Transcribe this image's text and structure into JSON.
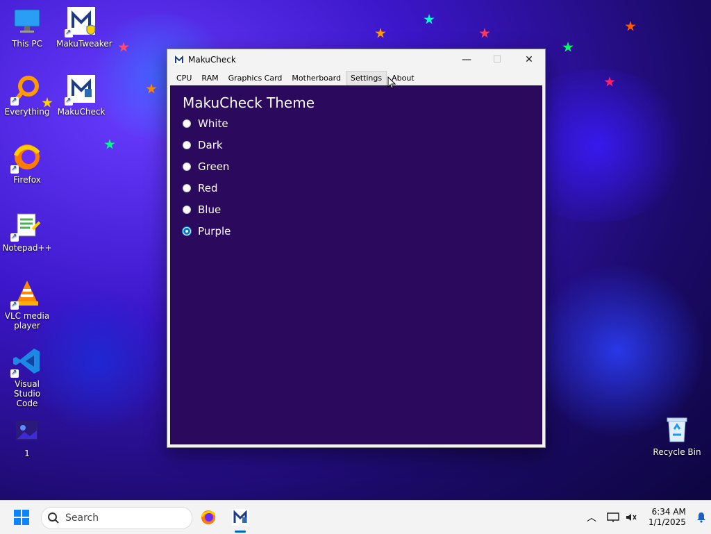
{
  "desktop": {
    "icons": [
      {
        "label": "This PC",
        "name": "this-pc"
      },
      {
        "label": "MakuTweaker",
        "name": "makutweaker"
      },
      {
        "label": "Everything",
        "name": "everything"
      },
      {
        "label": "MakuCheck",
        "name": "makucheck"
      },
      {
        "label": "Firefox",
        "name": "firefox"
      },
      {
        "label": "Notepad++",
        "name": "notepadplusplus"
      },
      {
        "label": "VLC media player",
        "name": "vlc"
      },
      {
        "label": "Visual Studio Code",
        "name": "vscode"
      },
      {
        "label": "1",
        "name": "folder-1"
      },
      {
        "label": "Recycle Bin",
        "name": "recycle-bin"
      }
    ]
  },
  "window": {
    "title": "MakuCheck",
    "menu": [
      "CPU",
      "RAM",
      "Graphics Card",
      "Motherboard",
      "Settings",
      "About"
    ],
    "active_menu": "Settings",
    "panel": {
      "heading": "MakuCheck Theme",
      "options": [
        "White",
        "Dark",
        "Green",
        "Red",
        "Blue",
        "Purple"
      ],
      "selected": "Purple",
      "bg_color": "#2b0a5d"
    }
  },
  "taskbar": {
    "search_placeholder": "Search",
    "time": "6:34 AM",
    "date": "1/1/2025"
  },
  "colors": {
    "accent": "#0078d4"
  }
}
